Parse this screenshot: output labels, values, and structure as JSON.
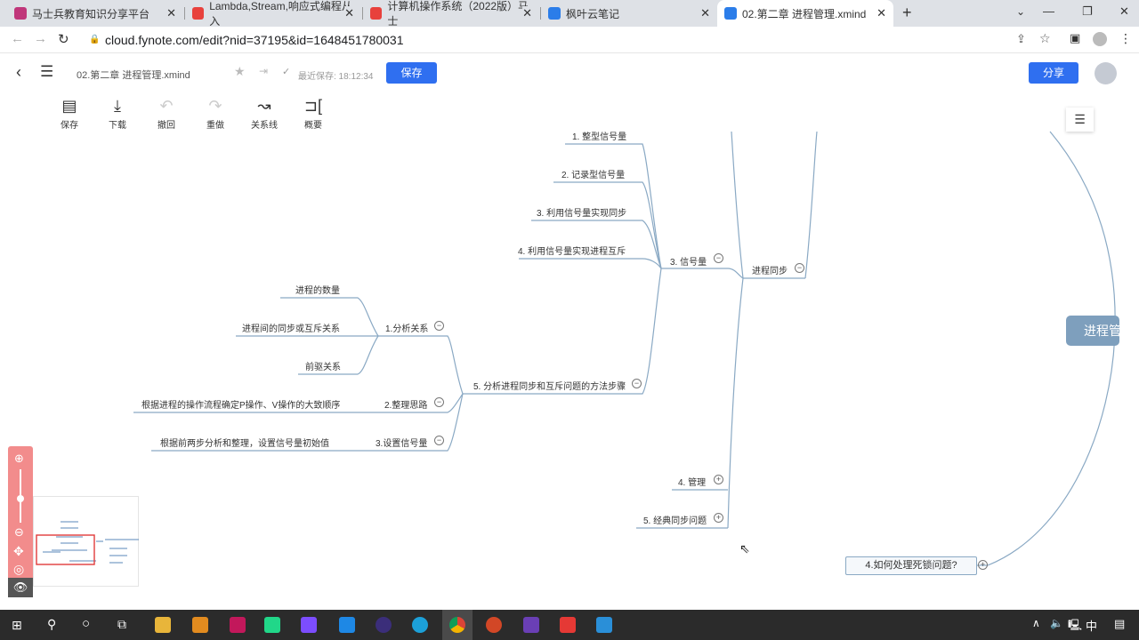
{
  "browser": {
    "tabs": [
      {
        "title": "马士兵教育知识分享平台",
        "color": "#c0367a"
      },
      {
        "title": "Lambda,Stream,响应式编程从入",
        "color": "#e8413c"
      },
      {
        "title": "计算机操作系统（2022版）马士",
        "color": "#e8413c"
      },
      {
        "title": "枫叶云笔记",
        "color": "#2b7de9"
      },
      {
        "title": "02.第二章 进程管理.xmind",
        "color": "#2b7de9",
        "active": true
      }
    ],
    "url": "cloud.fynote.com/edit?nid=37195&id=1648451780031"
  },
  "header": {
    "file_name": "02.第二章 进程管理.xmind",
    "last_saved": "最近保存: 18:12:34",
    "save_button": "保存",
    "share_button": "分享"
  },
  "toolbar": [
    {
      "label": "保存",
      "icon": "save-icon",
      "glyph": "▤"
    },
    {
      "label": "下载",
      "icon": "download-icon",
      "glyph": "⤓"
    },
    {
      "label": "撤回",
      "icon": "undo-icon",
      "glyph": "↶"
    },
    {
      "label": "重做",
      "icon": "redo-icon",
      "glyph": "↷"
    },
    {
      "label": "关系线",
      "icon": "relation-line-icon",
      "glyph": "↝"
    },
    {
      "label": "概要",
      "icon": "summary-icon",
      "glyph": "⊐["
    }
  ],
  "mindmap": {
    "central": "进程管",
    "n_sync": "进程同步",
    "n_sem": "3. 信号量",
    "sem_children": [
      "1. 整型信号量",
      "2. 记录型信号量",
      "3. 利用信号量实现同步",
      "4. 利用信号量实现进程互斥"
    ],
    "n_steps": "5. 分析进程同步和互斥问题的方法步骤",
    "step1": "1.分析关系",
    "step1_children": [
      "进程的数量",
      "进程间的同步或互斥关系",
      "前驱关系"
    ],
    "step2": "2.整理思路",
    "step2_child": "根据进程的操作流程确定P操作、V操作的大致顺序",
    "step3": "3.设置信号量",
    "step3_child": "根据前两步分析和整理，设置信号量初始值",
    "n_monitor": "4. 管理",
    "n_classic": "5. 经典同步问题",
    "n_deadlock": "4.如何处理死锁问题?"
  },
  "taskbar": {
    "ime": "中"
  }
}
